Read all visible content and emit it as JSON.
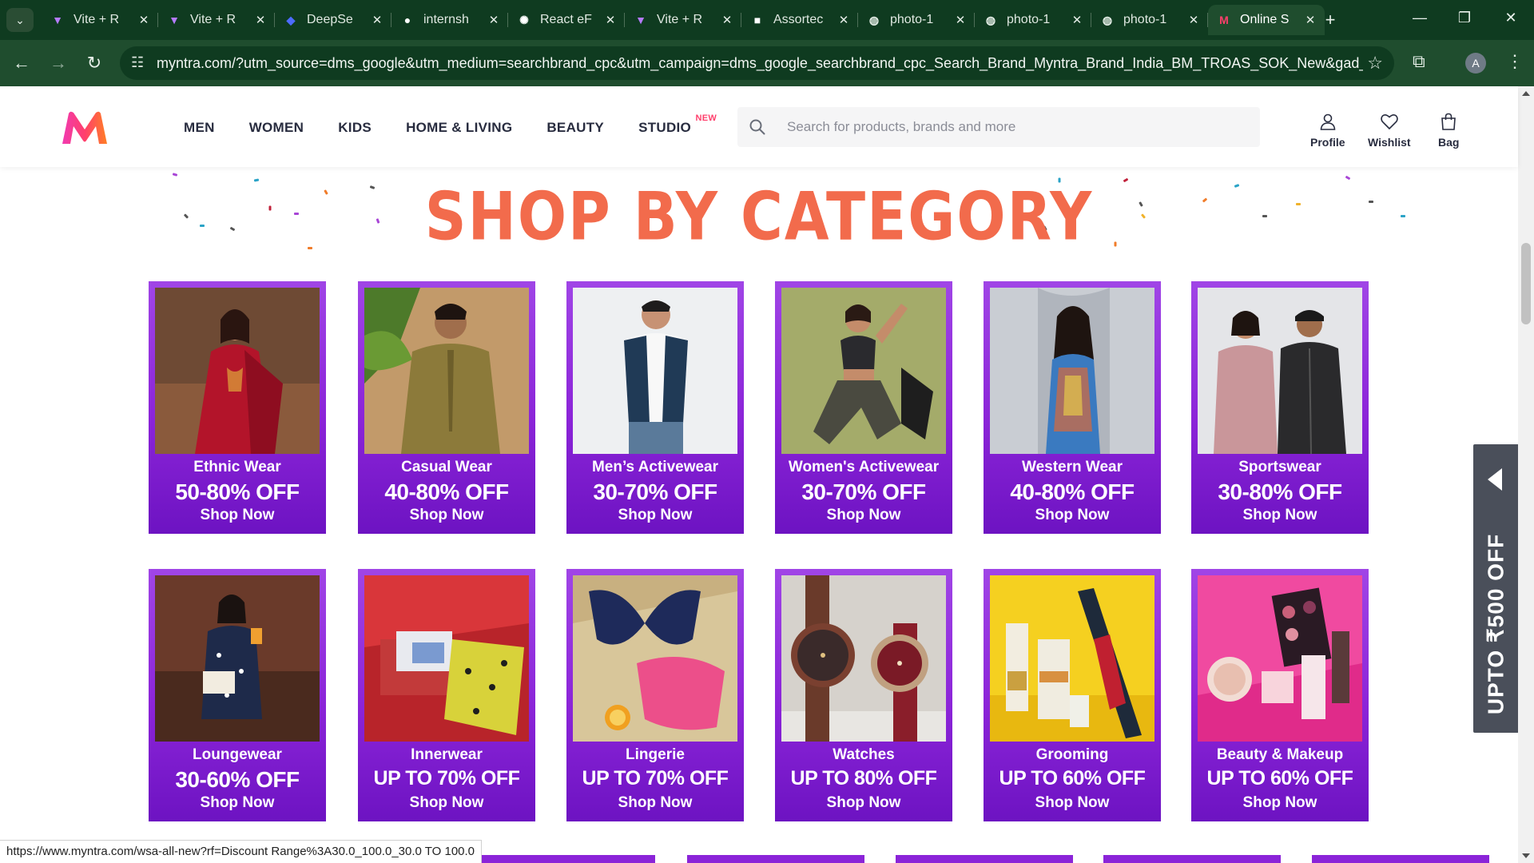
{
  "browser": {
    "tabs": [
      {
        "title": "Vite + R",
        "icon": "vite-icon"
      },
      {
        "title": "Vite + R",
        "icon": "vite-icon"
      },
      {
        "title": "DeepSe",
        "icon": "deepseek-icon"
      },
      {
        "title": "internsh",
        "icon": "github-icon"
      },
      {
        "title": "React eF",
        "icon": "openai-icon"
      },
      {
        "title": "Vite + R",
        "icon": "vite-icon"
      },
      {
        "title": "Assortec",
        "icon": "store-icon"
      },
      {
        "title": "photo-1",
        "icon": "globe-icon"
      },
      {
        "title": "photo-1",
        "icon": "globe-icon"
      },
      {
        "title": "photo-1",
        "icon": "globe-icon"
      },
      {
        "title": "Online S",
        "icon": "myntra-icon",
        "active": true
      }
    ],
    "url": "myntra.com/?utm_source=dms_google&utm_medium=searchbrand_cpc&utm_campaign=dms_google_searchbrand_cpc_Search_Brand_Myntra_Brand_India_BM_TROAS_SOK_New&gad_source...",
    "profile_initial": "A",
    "status_url": "https://www.myntra.com/wsa-all-new?rf=Discount Range%3A30.0_100.0_30.0 TO 100.0"
  },
  "header": {
    "nav": [
      "MEN",
      "WOMEN",
      "KIDS",
      "HOME & LIVING",
      "BEAUTY",
      "STUDIO"
    ],
    "studio_badge": "NEW",
    "search_placeholder": "Search for products, brands and more",
    "actions": {
      "profile": "Profile",
      "wishlist": "Wishlist",
      "bag": "Bag"
    },
    "brand_colors": {
      "accent": "#ff3f6c",
      "gradient_start": "#f13ab1",
      "gradient_end": "#ff7f25"
    }
  },
  "content": {
    "heading": "SHOP BY CATEGORY",
    "cta": "Shop Now",
    "categories": [
      {
        "title": "Ethnic Wear",
        "offer": "50-80% OFF"
      },
      {
        "title": "Casual Wear",
        "offer": "40-80% OFF"
      },
      {
        "title": "Men’s Activewear",
        "offer": "30-70% OFF"
      },
      {
        "title": "Women's Activewear",
        "offer": "30-70% OFF"
      },
      {
        "title": "Western Wear",
        "offer": "40-80% OFF"
      },
      {
        "title": "Sportswear",
        "offer": "30-80% OFF"
      },
      {
        "title": "Loungewear",
        "offer": "30-60% OFF"
      },
      {
        "title": "Innerwear",
        "offer": "UP TO 70% OFF"
      },
      {
        "title": "Lingerie",
        "offer": "UP TO 70% OFF"
      },
      {
        "title": "Watches",
        "offer": "UP TO 80% OFF"
      },
      {
        "title": "Grooming",
        "offer": "UP TO 60% OFF"
      },
      {
        "title": "Beauty & Makeup",
        "offer": "UP TO 60% OFF"
      }
    ],
    "side_promo": "UPTO ₹500 OFF",
    "card_color": "#8b24d8",
    "heading_color": "#f26b4c"
  }
}
